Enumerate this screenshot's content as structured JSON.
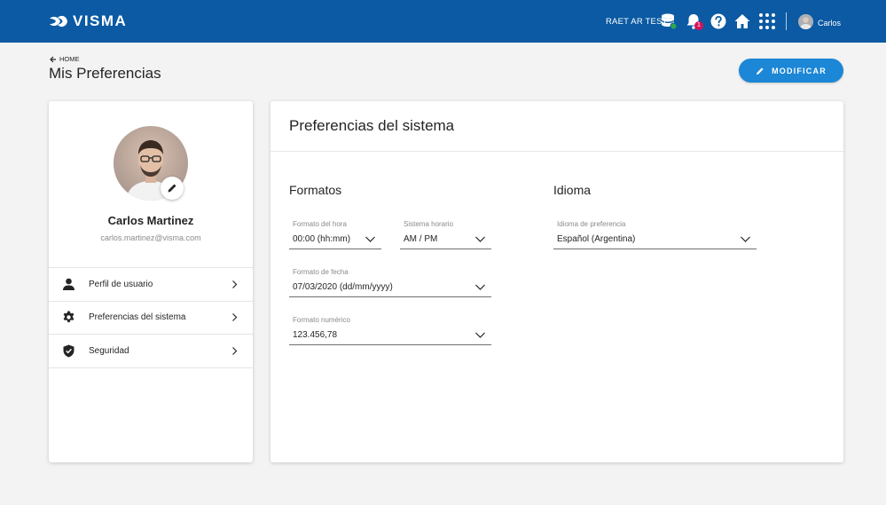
{
  "topbar": {
    "brand": "VISMA",
    "company": "RAET AR TEST",
    "notification_count": "1",
    "user_name": "Carlos",
    "icons": [
      "database-icon",
      "bell-icon",
      "help-icon",
      "home-icon",
      "apps-grid-icon"
    ],
    "background_color": "#0b5aa3"
  },
  "header": {
    "breadcrumb": "HOME",
    "title": "Mis Preferencias",
    "modify_button": "MODIFICAR"
  },
  "profile": {
    "name": "Carlos Martinez",
    "email": "carlos.martinez@visma.com",
    "menu": [
      {
        "label": "Perfil de usuario",
        "icon": "user-icon"
      },
      {
        "label": "Preferencias del sistema",
        "icon": "gear-icon"
      },
      {
        "label": "Seguridad",
        "icon": "shield-icon"
      }
    ]
  },
  "preferences": {
    "title": "Preferencias del sistema",
    "formats": {
      "title": "Formatos",
      "time_format": {
        "label": "Formato del hora",
        "value": "00:00 (hh:mm)"
      },
      "time_system": {
        "label": "Sistema horario",
        "value": "AM / PM"
      },
      "date_format": {
        "label": "Formato de fecha",
        "value": "07/03/2020 (dd/mm/yyyy)"
      },
      "number_format": {
        "label": "Formato numérico",
        "value": "123.456,78"
      }
    },
    "language": {
      "title": "Idioma",
      "preferred": {
        "label": "Idioma de preferencia",
        "value": "Español (Argentina)"
      }
    }
  },
  "colors": {
    "accent": "#1b87d6",
    "notification_badge": "#d4145a",
    "status_ok": "#2ea84a"
  }
}
